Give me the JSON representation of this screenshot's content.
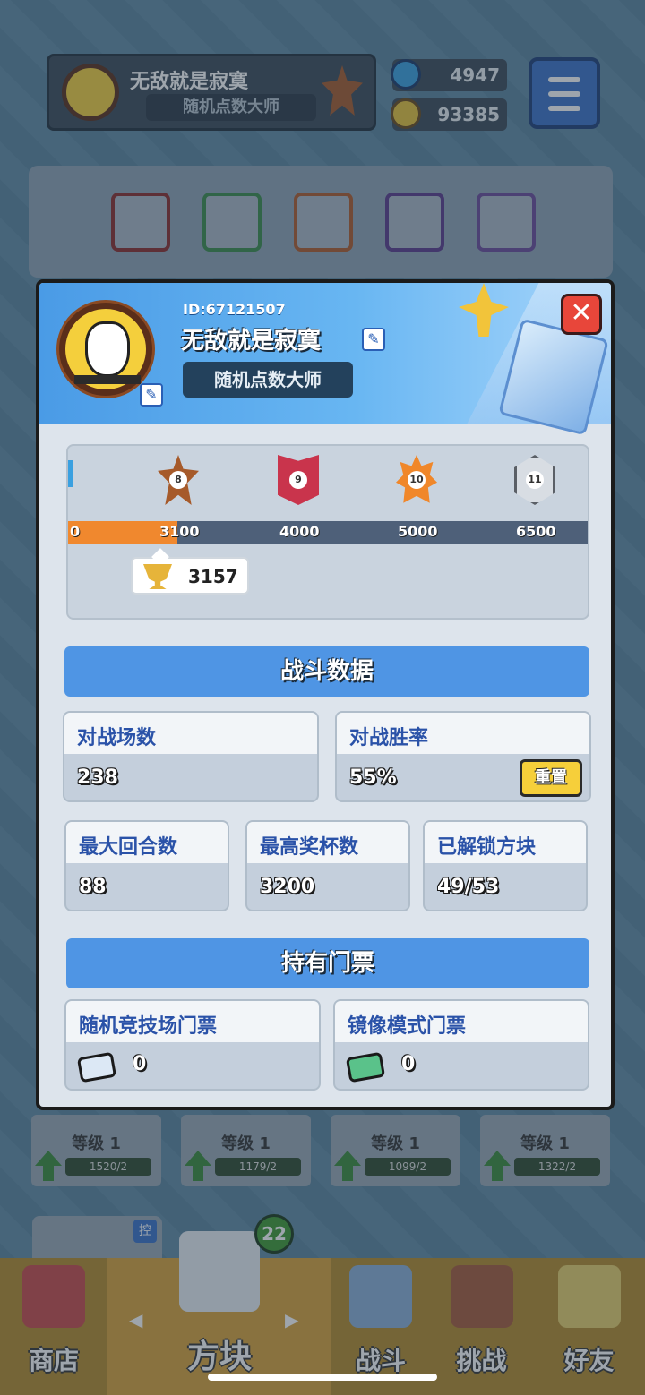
{
  "topbar": {
    "name": "无敌就是寂寞",
    "title": "随机点数大师",
    "gems": "4947",
    "coins": "93385",
    "rank_icon": "rank-star-8-icon"
  },
  "level_cards": [
    {
      "level": "等级 1",
      "progress": "1520/2"
    },
    {
      "level": "等级 1",
      "progress": "1179/2"
    },
    {
      "level": "等级 1",
      "progress": "1099/2"
    },
    {
      "level": "等级 1",
      "progress": "1322/2"
    }
  ],
  "tabs": [
    {
      "label": "商店"
    },
    {
      "label": "方块"
    },
    {
      "label": "战斗"
    },
    {
      "label": "挑战"
    },
    {
      "label": "好友"
    }
  ],
  "tab_badge": "22",
  "deck_tag": "控",
  "profile": {
    "id": "ID:67121507",
    "name": "无敌就是寂寞",
    "title": "随机点数大师",
    "close_label": "✕"
  },
  "rank": {
    "trophies": "3157",
    "current_fill_fraction": 0.12,
    "ticks": [
      {
        "value": "0"
      },
      {
        "value": "3100",
        "rank": "8"
      },
      {
        "value": "4000",
        "rank": "9"
      },
      {
        "value": "5000",
        "rank": "10"
      },
      {
        "value": "6500",
        "rank": "11"
      }
    ]
  },
  "battle": {
    "section_title": "战斗数据",
    "matches_label": "对战场数",
    "matches_value": "238",
    "winrate_label": "对战胜率",
    "winrate_value": "55%",
    "reset_label": "重置",
    "max_rounds_label": "最大回合数",
    "max_rounds_value": "88",
    "max_trophies_label": "最高奖杯数",
    "max_trophies_value": "3200",
    "unlocked_label": "已解锁方块",
    "unlocked_value": "49/53"
  },
  "tickets": {
    "section_title": "持有门票",
    "random_arena_label": "随机竞技场门票",
    "random_arena_value": "0",
    "mirror_label": "镜像模式门票",
    "mirror_value": "0"
  },
  "colors": {
    "accent_blue": "#4f95e4",
    "progress_orange": "#f0882e",
    "close_red": "#e8463a",
    "reset_yellow": "#f6cf3a"
  }
}
